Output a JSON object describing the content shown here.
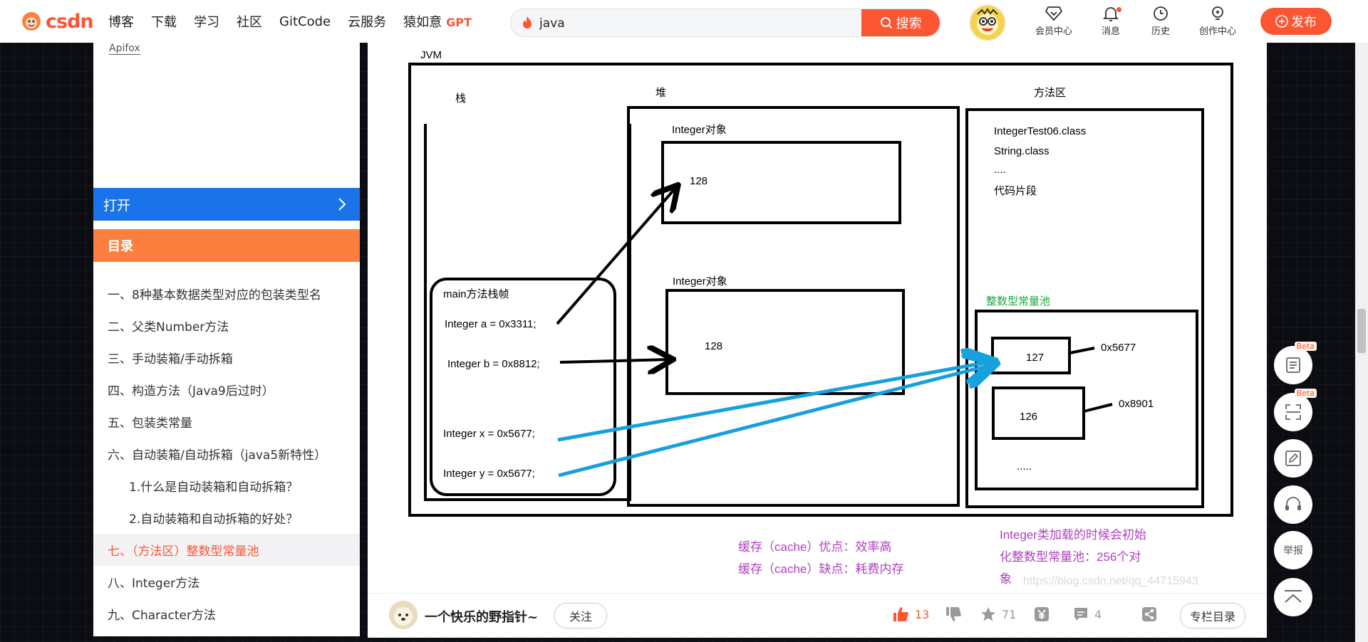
{
  "header": {
    "logo_text": "CSDN",
    "nav": [
      "博客",
      "下载",
      "学习",
      "社区",
      "GitCode",
      "云服务",
      "猿如意"
    ],
    "nav_gpt": "GPT",
    "search_value": "java",
    "search_button": "搜索",
    "icons": [
      {
        "label": "会员中心",
        "icon": "diamond-icon"
      },
      {
        "label": "消息",
        "icon": "bell-icon"
      },
      {
        "label": "历史",
        "icon": "clock-icon"
      },
      {
        "label": "创作中心",
        "icon": "bulb-icon"
      }
    ],
    "publish": "发布",
    "accent": "#fc5531"
  },
  "sidebar": {
    "apifox": "Apifox",
    "open_label": "打开",
    "toc_title": "目录",
    "toc": [
      {
        "label": "一、8种基本数据类型对应的包装类型名"
      },
      {
        "label": "二、父类Number方法"
      },
      {
        "label": "三、手动装箱/手动拆箱"
      },
      {
        "label": "四、构造方法（Java9后过时）"
      },
      {
        "label": "五、包装类常量"
      },
      {
        "label": "六、自动装箱/自动拆箱（java5新特性）"
      },
      {
        "label": "1.什么是自动装箱和自动拆箱？"
      },
      {
        "label": "2.自动装箱和自动拆箱的好处？"
      },
      {
        "label": "七、（方法区）整数型常量池"
      },
      {
        "label": "八、Integer方法"
      },
      {
        "label": "九、Character方法"
      }
    ]
  },
  "diagram": {
    "jvm": "JVM",
    "stack": "栈",
    "heap": "堆",
    "method_area": "方法区",
    "heap_obj1_title": "Integer对象",
    "heap_obj1_value": "128",
    "heap_obj2_title": "Integer对象",
    "heap_obj2_value": "128",
    "method_lines": [
      "IntegerTest06.class",
      "String.class",
      "....",
      "代码片段"
    ],
    "pool_title": "整数型常量池",
    "pool_127": "127",
    "pool_127_addr": "0x5677",
    "pool_126": "126",
    "pool_126_addr": "0x8901",
    "pool_more": ".....",
    "frame_title": "main方法栈帧",
    "var_a": "Integer a = 0x3311;",
    "var_b": "Integer b = 0x8812;",
    "var_x": "Integer x = 0x5677;",
    "var_y": "Integer y =  0x5677;",
    "note_pro": "缓存（cache）优点：效率高",
    "note_con": "缓存（cache）缺点：耗费内存",
    "note_init": [
      "Integer类加载的时候会初始",
      "化整数型常量池：256个对",
      "象"
    ],
    "watermark": "https://blog.csdn.net/qq_44715943",
    "pool_color": "#19a83c",
    "note_color": "#b040c0",
    "arrow_blue": "#16a0dc"
  },
  "footer": {
    "author": "一个快乐的野指针~",
    "follow": "关注",
    "likes": "13",
    "stars": "71",
    "comments": "4",
    "column_btn": "专栏目录"
  },
  "float": {
    "beta": "Beta",
    "report": "举报"
  }
}
